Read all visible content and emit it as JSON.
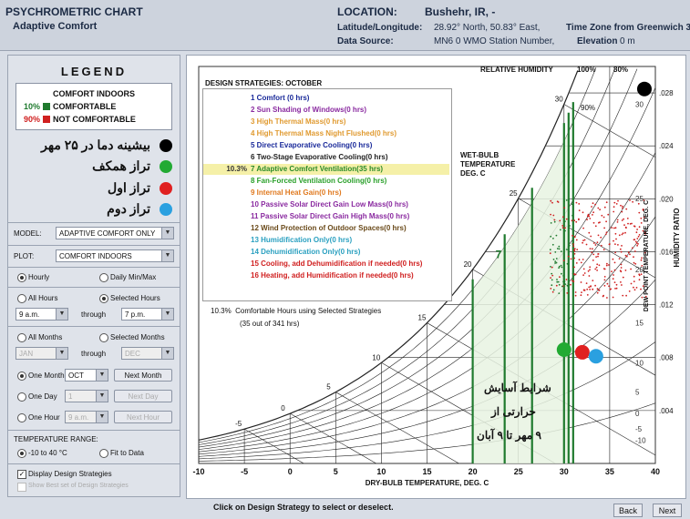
{
  "header": {
    "title": "PSYCHROMETRIC CHART",
    "subtitle": "Adaptive Comfort",
    "location_label": "LOCATION:",
    "location_value": "Bushehr, IR, -",
    "latlon_label": "Latitude/Longitude:",
    "latlon_value": "28.92° North, 50.83° East,",
    "tz_label": "Time Zone from Greenwich 3",
    "source_label": "Data Source:",
    "source_value": "MN6    0 WMO Station Number,",
    "elev_label": "Elevation",
    "elev_value": "0 m"
  },
  "legend": {
    "title": "LEGEND",
    "box_title": "COMFORT INDOORS",
    "comfortable_pct": "10%",
    "comfortable_label": "COMFORTABLE",
    "not_comfortable_pct": "90%",
    "not_comfortable_label": "NOT COMFORTABLE",
    "persian_items": [
      {
        "text": "بیشینه دما در ۲۵ مهر",
        "color": "#000000"
      },
      {
        "text": "تراز همکف",
        "color": "#22aa33"
      },
      {
        "text": "تراز اول",
        "color": "#e02020"
      },
      {
        "text": "تراز دوم",
        "color": "#2aa0e0"
      }
    ]
  },
  "controls": {
    "model_label": "MODEL:",
    "model_value": "ADAPTIVE COMFORT ONLY",
    "plot_label": "PLOT:",
    "plot_value": "COMFORT INDOORS",
    "hourly": "Hourly",
    "daily": "Daily Min/Max",
    "all_hours": "All Hours",
    "selected_hours": "Selected Hours",
    "hour_from": "9 a.m.",
    "through": "through",
    "hour_to": "7 p.m.",
    "all_months": "All Months",
    "selected_months": "Selected Months",
    "month_from": "JAN",
    "month_to": "DEC",
    "one_month": "One Month",
    "one_month_value": "OCT",
    "next_month": "Next Month",
    "one_day": "One Day",
    "day_value": "1",
    "next_day": "Next Day",
    "one_hour": "One Hour",
    "hour_value": "9 a.m.",
    "next_hour": "Next Hour",
    "temp_range_label": "TEMPERATURE RANGE:",
    "temp_range_a": "-10 to 40 °C",
    "temp_range_b": "Fit to Data",
    "display_strategies": "Display Design Strategies",
    "best_set": "Show Best set of Design Strategies"
  },
  "strategies": {
    "title": "DESIGN STRATEGIES: OCTOBER",
    "items": [
      {
        "pct": "",
        "text": "1 Comfort (0 hrs)",
        "color": "#1a2a9a"
      },
      {
        "pct": "",
        "text": "2 Sun Shading of Windows(0 hrs)",
        "color": "#8a2aa0"
      },
      {
        "pct": "",
        "text": "3 High Thermal Mass(0 hrs)",
        "color": "#e09a30"
      },
      {
        "pct": "",
        "text": "4 High Thermal Mass Night Flushed(0 hrs)",
        "color": "#e09a30"
      },
      {
        "pct": "",
        "text": "5 Direct Evaporative Cooling(0 hrs)",
        "color": "#1a2a9a"
      },
      {
        "pct": "",
        "text": "6 Two-Stage Evaporative Cooling(0 hrs)",
        "color": "#222222"
      },
      {
        "pct": "10.3%",
        "text": "7 Adaptive Comfort Ventilation(35 hrs)",
        "color": "#2a8a2a",
        "highlight": true
      },
      {
        "pct": "",
        "text": "8 Fan-Forced Ventilation Cooling(0 hrs)",
        "color": "#2aa02a"
      },
      {
        "pct": "",
        "text": "9 Internal Heat Gain(0 hrs)",
        "color": "#e07a20"
      },
      {
        "pct": "",
        "text": "10 Passive Solar Direct Gain Low Mass(0 hrs)",
        "color": "#8a2aa0"
      },
      {
        "pct": "",
        "text": "11 Passive Solar Direct Gain High Mass(0 hrs)",
        "color": "#8a2aa0"
      },
      {
        "pct": "",
        "text": "12 Wind Protection of Outdoor Spaces(0 hrs)",
        "color": "#6a4a1a"
      },
      {
        "pct": "",
        "text": "13 Humidification Only(0 hrs)",
        "color": "#2aa0c0"
      },
      {
        "pct": "",
        "text": "14 Dehumidification Only(0 hrs)",
        "color": "#2aa0c0"
      },
      {
        "pct": "",
        "text": "15 Cooling, add Dehumidification if needed(0 hrs)",
        "color": "#d02020"
      },
      {
        "pct": "",
        "text": "16 Heating, add Humidification if needed(0 hrs)",
        "color": "#d02020"
      }
    ],
    "summary_pct": "10.3%",
    "summary_line1": "Comfortable Hours using Selected Strategies",
    "summary_line2": "(35 out of 341 hrs)"
  },
  "chart": {
    "rh_label": "RELATIVE HUMIDITY",
    "rh_100": "100%",
    "rh_80": "80%",
    "rh_90": "90%",
    "wb_label_1": "WET-BULB",
    "wb_label_2": "TEMPERATURE",
    "wb_label_3": "DEG. C",
    "dp_label": "DEW POINT TEMPERATURE, DEG. C",
    "hr_label": "HUMIDITY RATIO",
    "x_label": "DRY-BULB TEMPERATURE, DEG. C",
    "zone_label": "7",
    "x_ticks": [
      "-10",
      "-5",
      "0",
      "5",
      "10",
      "15",
      "20",
      "25",
      "30",
      "35",
      "40"
    ],
    "hr_ticks": [
      ".028",
      ".024",
      ".020",
      ".016",
      ".012",
      ".008",
      ".004"
    ],
    "dp_ticks": [
      "30",
      "25",
      "20",
      "15",
      "10",
      "5",
      "0",
      "-5",
      "-10"
    ],
    "wb_ticks": [
      "30",
      "25",
      "20",
      "15",
      "10",
      "5",
      "0",
      "-5"
    ],
    "note_lines": [
      "شرایط آسایش",
      "حرارتی از",
      "۹ مهر تا ۹ آبان"
    ]
  },
  "footer": {
    "hint": "Click on Design Strategy to select or deselect.",
    "back": "Back",
    "next": "Next"
  }
}
